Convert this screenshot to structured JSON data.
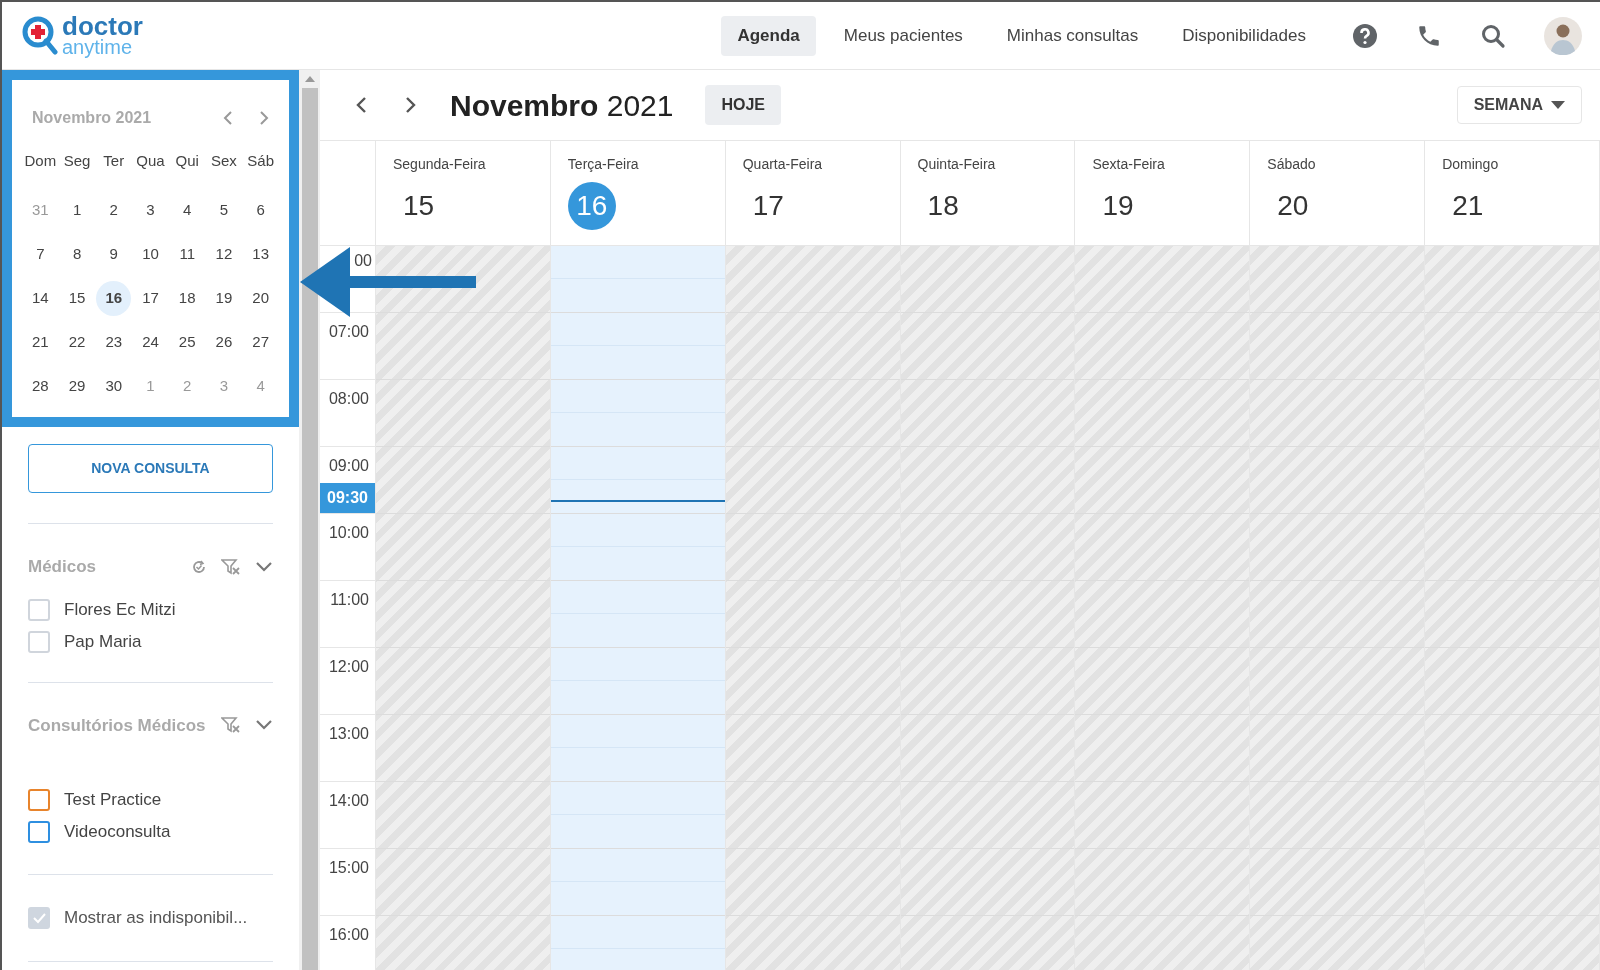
{
  "logo": {
    "word1": "doctor",
    "word2": "anytime"
  },
  "nav": [
    {
      "label": "Agenda",
      "selected": true
    },
    {
      "label": "Meus pacientes",
      "selected": false
    },
    {
      "label": "Minhas consultas",
      "selected": false
    },
    {
      "label": "Disponibilidades",
      "selected": false
    }
  ],
  "mini_calendar": {
    "title": "Novembro 2021",
    "weekdays": [
      "Dom",
      "Seg",
      "Ter",
      "Qua",
      "Qui",
      "Sex",
      "Sáb"
    ],
    "weeks": [
      [
        {
          "day": "31",
          "muted": true,
          "selected": false
        },
        {
          "day": "1",
          "muted": false,
          "selected": false
        },
        {
          "day": "2",
          "muted": false,
          "selected": false
        },
        {
          "day": "3",
          "muted": false,
          "selected": false
        },
        {
          "day": "4",
          "muted": false,
          "selected": false
        },
        {
          "day": "5",
          "muted": false,
          "selected": false
        },
        {
          "day": "6",
          "muted": false,
          "selected": false
        }
      ],
      [
        {
          "day": "7",
          "muted": false,
          "selected": false
        },
        {
          "day": "8",
          "muted": false,
          "selected": false
        },
        {
          "day": "9",
          "muted": false,
          "selected": false
        },
        {
          "day": "10",
          "muted": false,
          "selected": false
        },
        {
          "day": "11",
          "muted": false,
          "selected": false
        },
        {
          "day": "12",
          "muted": false,
          "selected": false
        },
        {
          "day": "13",
          "muted": false,
          "selected": false
        }
      ],
      [
        {
          "day": "14",
          "muted": false,
          "selected": false
        },
        {
          "day": "15",
          "muted": false,
          "selected": false
        },
        {
          "day": "16",
          "muted": false,
          "selected": true
        },
        {
          "day": "17",
          "muted": false,
          "selected": false
        },
        {
          "day": "18",
          "muted": false,
          "selected": false
        },
        {
          "day": "19",
          "muted": false,
          "selected": false
        },
        {
          "day": "20",
          "muted": false,
          "selected": false
        }
      ],
      [
        {
          "day": "21",
          "muted": false,
          "selected": false
        },
        {
          "day": "22",
          "muted": false,
          "selected": false
        },
        {
          "day": "23",
          "muted": false,
          "selected": false
        },
        {
          "day": "24",
          "muted": false,
          "selected": false
        },
        {
          "day": "25",
          "muted": false,
          "selected": false
        },
        {
          "day": "26",
          "muted": false,
          "selected": false
        },
        {
          "day": "27",
          "muted": false,
          "selected": false
        }
      ],
      [
        {
          "day": "28",
          "muted": false,
          "selected": false
        },
        {
          "day": "29",
          "muted": false,
          "selected": false
        },
        {
          "day": "30",
          "muted": false,
          "selected": false
        },
        {
          "day": "1",
          "muted": true,
          "selected": false
        },
        {
          "day": "2",
          "muted": true,
          "selected": false
        },
        {
          "day": "3",
          "muted": true,
          "selected": false
        },
        {
          "day": "4",
          "muted": true,
          "selected": false
        }
      ]
    ]
  },
  "new_button": "NOVA CONSULTA",
  "filters": [
    {
      "title": "Médicos",
      "refresh": true,
      "items": [
        {
          "label": "Flores Ec Mitzi",
          "checked": false
        },
        {
          "label": "Pap Maria",
          "checked": false
        }
      ]
    },
    {
      "title": "Consultórios Médicos",
      "refresh": false,
      "items": [
        {
          "label": "Test Practice",
          "checked": false,
          "color": "#e8842c"
        },
        {
          "label": "Videoconsulta",
          "checked": false,
          "color": "#2e8fe0"
        }
      ]
    }
  ],
  "show_unavailability": {
    "label": "Mostrar as indisponibil...",
    "checked": true
  },
  "toolbar": {
    "month": "Novembro",
    "year": "2021",
    "today_button": "HOJE",
    "view": "SEMANA"
  },
  "days": [
    {
      "name": "Segunda-Feira",
      "number": "15",
      "today": false
    },
    {
      "name": "Terça-Feira",
      "number": "16",
      "today": true
    },
    {
      "name": "Quarta-Feira",
      "number": "17",
      "today": false
    },
    {
      "name": "Quinta-Feira",
      "number": "18",
      "today": false
    },
    {
      "name": "Sexta-Feira",
      "number": "19",
      "today": false
    },
    {
      "name": "Sábado",
      "number": "20",
      "today": false
    },
    {
      "name": "Domingo",
      "number": "21",
      "today": false
    }
  ],
  "hours": [
    {
      "label": "00"
    },
    {
      "label": "07:00"
    },
    {
      "label": "08:00"
    },
    {
      "label": "09:00",
      "now": "09:30"
    },
    {
      "label": "10:00"
    },
    {
      "label": "11:00"
    },
    {
      "label": "12:00"
    },
    {
      "label": "13:00"
    },
    {
      "label": "14:00"
    },
    {
      "label": "15:00"
    },
    {
      "label": "16:00"
    }
  ]
}
